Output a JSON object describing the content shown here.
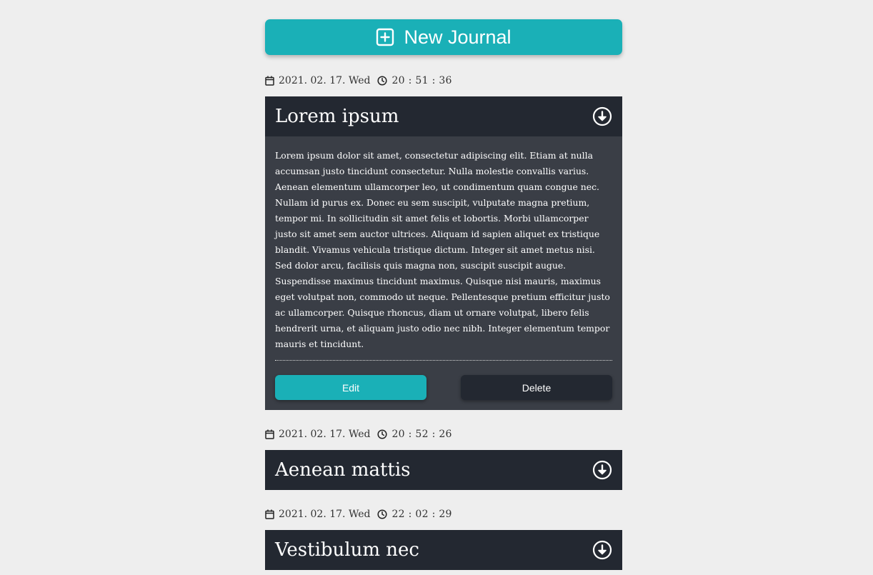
{
  "header": {
    "new_journal_label": "New Journal",
    "icon": "plus-square-icon"
  },
  "colors": {
    "accent": "#1ab0b7",
    "card_header": "#232831",
    "card_body": "#3a3e46",
    "page_bg": "#eeeeee"
  },
  "entries": [
    {
      "date": "2021. 02. 17. Wed",
      "time": "20 : 51 : 36",
      "title": "Lorem ipsum",
      "expanded": true,
      "body": "Lorem ipsum dolor sit amet, consectetur adipiscing elit. Etiam at nulla accumsan justo tincidunt consectetur. Nulla molestie convallis varius. Aenean elementum ullamcorper leo, ut condimentum quam congue nec. Nullam id purus ex. Donec eu sem suscipit, vulputate magna pretium, tempor mi. In sollicitudin sit amet felis et lobortis. Morbi ullamcorper justo sit amet sem auctor ultrices. Aliquam id sapien aliquet ex tristique blandit. Vivamus vehicula tristique dictum. Integer sit amet metus nisi. Sed dolor arcu, facilisis quis magna non, suscipit suscipit augue. Suspendisse maximus tincidunt maximus. Quisque nisi mauris, maximus eget volutpat non, commodo ut neque. Pellentesque pretium efficitur justo ac ullamcorper. Quisque rhoncus, diam ut ornare volutpat, libero felis hendrerit urna, et aliquam justo odio nec nibh. Integer elementum tempor mauris et tincidunt.",
      "edit_label": "Edit",
      "delete_label": "Delete"
    },
    {
      "date": "2021. 02. 17. Wed",
      "time": "20 : 52 : 26",
      "title": "Aenean mattis",
      "expanded": false
    },
    {
      "date": "2021. 02. 17. Wed",
      "time": "22 : 02 : 29",
      "title": "Vestibulum nec",
      "expanded": false
    }
  ]
}
